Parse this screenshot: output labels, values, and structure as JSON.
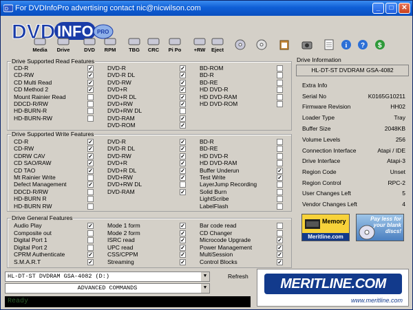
{
  "window": {
    "title": "For DVDInfoPro advertising contact nic@nicwilson.com"
  },
  "logo": {
    "text": "DVDInfo",
    "badge": "PRO"
  },
  "toolbar": [
    "Media",
    "Drive",
    "DVD",
    "RPM",
    "TBG",
    "CRC",
    "Pi Po",
    "+RW",
    "Eject"
  ],
  "read": {
    "title": "Drive Supported Read Features",
    "cols": [
      [
        [
          "CD-R",
          true
        ],
        [
          "CD-RW",
          true
        ],
        [
          "CD Multi Read",
          true
        ],
        [
          "CD Method 2",
          true
        ],
        [
          "Mount Rainier Read",
          false
        ],
        [
          "DDCD-R/RW",
          false
        ],
        [
          "HD-BURN-R",
          false
        ],
        [
          "HD-BURN-RW",
          false
        ]
      ],
      [
        [
          "DVD-R",
          true
        ],
        [
          "DVD-R DL",
          true
        ],
        [
          "DVD-RW",
          true
        ],
        [
          "DVD+R",
          true
        ],
        [
          "DVD+R DL",
          true
        ],
        [
          "DVD+RW",
          true
        ],
        [
          "DVD+RW DL",
          false
        ],
        [
          "DVD-RAM",
          true
        ],
        [
          "DVD-ROM",
          true
        ]
      ],
      [
        [
          "BD-ROM",
          false
        ],
        [
          "BD-R",
          false
        ],
        [
          "BD-RE",
          false
        ],
        [
          "HD DVD-R",
          false
        ],
        [
          "HD DVD-RAM",
          false
        ],
        [
          "HD DVD-ROM",
          false
        ]
      ]
    ]
  },
  "write": {
    "title": "Drive Supported Write Features",
    "cols": [
      [
        [
          "CD-R",
          true
        ],
        [
          "CD-RW",
          true
        ],
        [
          "CDRW CAV",
          true
        ],
        [
          "CD SAO/RAW",
          true
        ],
        [
          "CD TAO",
          true
        ],
        [
          "Mt Rainier Write",
          false
        ],
        [
          "Defect Management",
          true
        ],
        [
          "DDCD-R/RW",
          false
        ],
        [
          "HD-BURN R",
          false
        ],
        [
          "HD-BURN RW",
          false
        ]
      ],
      [
        [
          "DVD-R",
          true
        ],
        [
          "DVD-R DL",
          true
        ],
        [
          "DVD-RW",
          true
        ],
        [
          "DVD+R",
          true
        ],
        [
          "DVD+R DL",
          true
        ],
        [
          "DVD+RW",
          true
        ],
        [
          "DVD+RW DL",
          false
        ],
        [
          "DVD-RAM",
          true
        ]
      ],
      [
        [
          "BD-R",
          false
        ],
        [
          "BD-RE",
          false
        ],
        [
          "HD DVD-R",
          false
        ],
        [
          "HD DVD-RAM",
          false
        ],
        [
          "Buffer Underun",
          true
        ],
        [
          "Test Write",
          true
        ],
        [
          "LayerJump Recording",
          false
        ],
        [
          "Solid Burn",
          false
        ],
        [
          "LightScribe",
          false
        ],
        [
          "LabelFlash",
          false
        ]
      ]
    ]
  },
  "general": {
    "title": "Drive General Features",
    "cols": [
      [
        [
          "Audio Play",
          true
        ],
        [
          "Composite out",
          false
        ],
        [
          "Digital Port 1",
          false
        ],
        [
          "Digital Port 2",
          false
        ],
        [
          "CPRM Authenticate",
          true
        ],
        [
          "S.M.A.R.T",
          true
        ]
      ],
      [
        [
          "Mode 1 form",
          true
        ],
        [
          "Mode 2 form",
          true
        ],
        [
          "ISRC read",
          true
        ],
        [
          "UPC read",
          true
        ],
        [
          "CSS/CPPM",
          true
        ],
        [
          "Streaming",
          true
        ]
      ],
      [
        [
          "Bar code read",
          false
        ],
        [
          "CD Changer",
          false
        ],
        [
          "Microcode Upgrade",
          true
        ],
        [
          "Power Management",
          true
        ],
        [
          "MultiSession",
          true
        ],
        [
          "Control Blocks",
          true
        ]
      ]
    ]
  },
  "info": {
    "title": "Drive Information",
    "drive": "HL-DT-ST DVDRAM GSA-4082",
    "extra": "Extra Info",
    "rows": [
      [
        "Serial No",
        "K0165G10211"
      ],
      [
        "Firmware Revision",
        "HH02"
      ],
      [
        "Loader Type",
        "Tray"
      ],
      [
        "Buffer Size",
        "2048KB"
      ],
      [
        "Volume Levels",
        "256"
      ],
      [
        "Connection Interface",
        "Atapi / IDE"
      ],
      [
        "Drive Interface",
        "Atapi-3"
      ],
      [
        "Region Code",
        "Unset"
      ],
      [
        "Region Control",
        "RPC-2"
      ],
      [
        "User Changes Left",
        "5"
      ],
      [
        "Vendor Changes Left",
        "4"
      ]
    ]
  },
  "ads": {
    "memory": "Memory",
    "meritline": "Meritline.com",
    "payless": "Pay less for your blank discs!"
  },
  "bottom": {
    "drive_select": "HL-DT-ST DVDRAM GSA-4082 (D:)",
    "commands": "ADVANCED COMMANDS",
    "refresh": "Refresh",
    "status": "Ready",
    "merit_big": "MERITLINE.COM",
    "merit_url": "www.meritline.com"
  },
  "colors": {
    "title_blue": "#0f5fd6",
    "logo_blue": "#1a3ca8",
    "merit_blue": "#123a8c"
  }
}
